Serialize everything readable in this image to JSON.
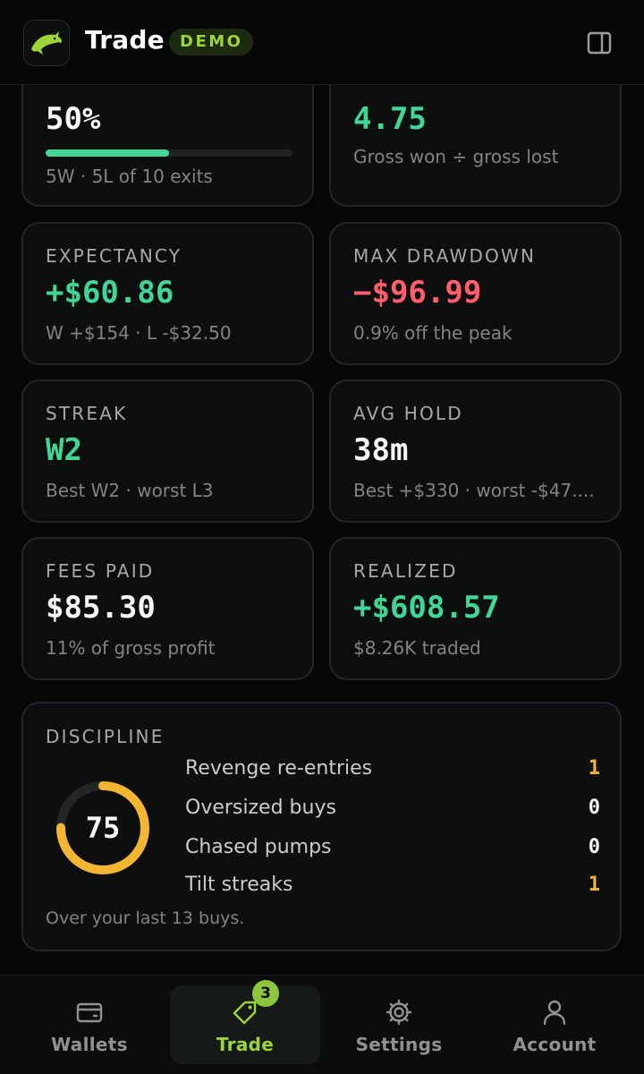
{
  "header": {
    "title": "Trade",
    "badge": "DEMO",
    "logo_icon": "dolphin-icon",
    "panel_icon": "sidebar-panel-icon",
    "accent": "#9ed339"
  },
  "cards": {
    "win_rate": {
      "value": "50%",
      "sub": "5W · 5L of 10 exits",
      "progress": 0.5
    },
    "profit_factor": {
      "value": "4.75",
      "sub": "Gross won ÷ gross lost"
    },
    "expectancy": {
      "label": "EXPECTANCY",
      "value": "+$60.86",
      "sub": "W +$154 · L -$32.50"
    },
    "max_drawdown": {
      "label": "MAX DRAWDOWN",
      "value": "−$96.99",
      "sub": "0.9% off the peak"
    },
    "streak": {
      "label": "STREAK",
      "value": "W2",
      "sub": "Best W2 · worst L3"
    },
    "avg_hold": {
      "label": "AVG HOLD",
      "value": "38m",
      "sub": "Best +$330 · worst -$47...."
    },
    "fees_paid": {
      "label": "FEES PAID",
      "value": "$85.30",
      "sub": "11% of gross profit"
    },
    "realized": {
      "label": "REALIZED",
      "value": "+$608.57",
      "sub": "$8.26K traded"
    }
  },
  "discipline": {
    "label": "DISCIPLINE",
    "score": "75",
    "score_fraction": 0.75,
    "rows": [
      {
        "label": "Revenge re-entries",
        "value": "1"
      },
      {
        "label": "Oversized buys",
        "value": "0"
      },
      {
        "label": "Chased pumps",
        "value": "0"
      },
      {
        "label": "Tilt streaks",
        "value": "1"
      }
    ],
    "footer": "Over your last 13 buys."
  },
  "nav": {
    "items": [
      {
        "label": "Wallets",
        "icon": "wallet-icon"
      },
      {
        "label": "Trade",
        "icon": "tag-icon",
        "badge": "3",
        "active": true
      },
      {
        "label": "Settings",
        "icon": "gear-icon"
      },
      {
        "label": "Account",
        "icon": "user-icon"
      }
    ]
  },
  "colors": {
    "positive": "#3fd696",
    "negative": "#ff5d6c",
    "warning": "#f2b632",
    "active_nav": "#9ed339"
  }
}
